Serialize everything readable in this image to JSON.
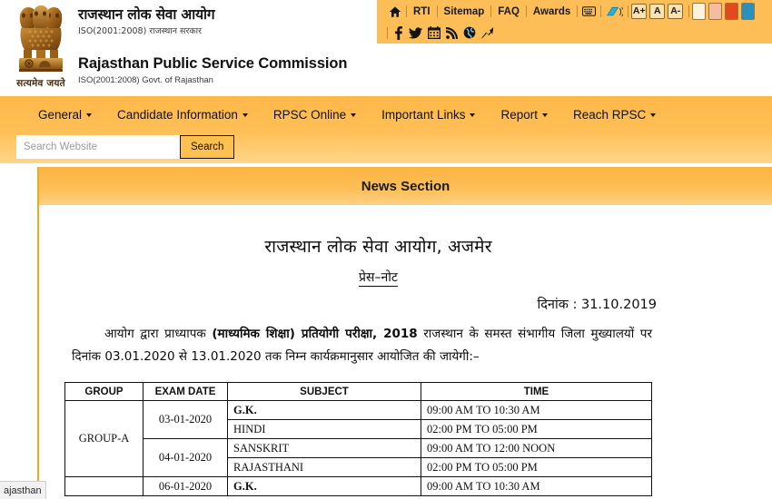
{
  "header": {
    "emblem_motto": "सत्यमेव जयते",
    "emblem_name": "ashoka-emblem",
    "title_hindi": "राजस्थान लोक सेवा आयोग",
    "subtitle_hindi": "ISO(2001:2008) राजस्थान सरकार",
    "title_english": "Rajasthan Public Service Commission",
    "subtitle_english": "ISO(2001:2008) Govt. of Rajasthan"
  },
  "utility_bar": {
    "links": [
      "RTI",
      "Sitemap",
      "FAQ",
      "Awards"
    ],
    "home_icon": "home-icon",
    "icons": [
      "keyboard-icon",
      "sign-language-icon"
    ],
    "font_buttons": [
      "A+",
      "A",
      "A-"
    ],
    "theme_swatches": [
      "#FDF3DC",
      "#F5BCA0",
      "#E24A1E",
      "#2C90BC"
    ],
    "social_icons": [
      "facebook-icon",
      "twitter-icon",
      "calendar-icon",
      "rss-icon",
      "globe-icon",
      "pin-icon"
    ]
  },
  "nav": {
    "menu": [
      {
        "label": "General"
      },
      {
        "label": "Candidate Information"
      },
      {
        "label": "RPSC Online"
      },
      {
        "label": "Important Links"
      },
      {
        "label": "Report"
      },
      {
        "label": "Reach RPSC"
      }
    ]
  },
  "search": {
    "placeholder": "Search Website",
    "value": "",
    "button_label": "Search"
  },
  "news": {
    "section_title": "News Section",
    "doc_heading": "राजस्थान लोक सेवा आयोग, अजमेर",
    "doc_subheading": "प्रेस–नोट",
    "doc_date_label": "दिनांक :",
    "doc_date_value": "31.10.2019",
    "paragraph": {
      "part1": "आयोग द्वारा प्राध्यापक ",
      "bold1": "(माध्यमिक शिक्षा) प्रतियोगी परीक्षा, 2018",
      "part2": " राजस्थान के समस्त संभागीय जिला मुख्यालयों पर दिनांक ",
      "date_from": "03.01.2020",
      "part3": " से ",
      "date_to": "13.01.2020",
      "part4": " तक निम्न कार्यक्रमानुसार आयोजित की जायेगी:–"
    }
  },
  "schedule_table": {
    "headers": [
      "GROUP",
      "EXAM DATE",
      "SUBJECT",
      "TIME"
    ],
    "rows": [
      {
        "group": "GROUP-A",
        "group_rowspan": 4,
        "date": "03-01-2020",
        "date_rowspan": 2,
        "subject": "G.K.",
        "subject_bold": true,
        "time": "09:00 AM TO 10:30 AM"
      },
      {
        "group": "",
        "date": "",
        "subject": "HINDI",
        "subject_bold": false,
        "time": "02:00 PM TO 05:00 PM"
      },
      {
        "group": "",
        "date": "04-01-2020",
        "date_rowspan": 2,
        "subject": "SANSKRIT",
        "subject_bold": false,
        "time": "09:00 AM TO 12:00 NOON"
      },
      {
        "group": "",
        "date": "",
        "subject": "RAJASTHANI",
        "subject_bold": false,
        "time": "02:00 PM TO 05:00 PM"
      },
      {
        "group": "",
        "date": "06-01-2020",
        "date_rowspan": 2,
        "subject": "G.K.",
        "subject_bold": true,
        "time": "09:00 AM TO 10:30 AM"
      }
    ]
  },
  "status_bar": {
    "text": "ajasthan"
  }
}
